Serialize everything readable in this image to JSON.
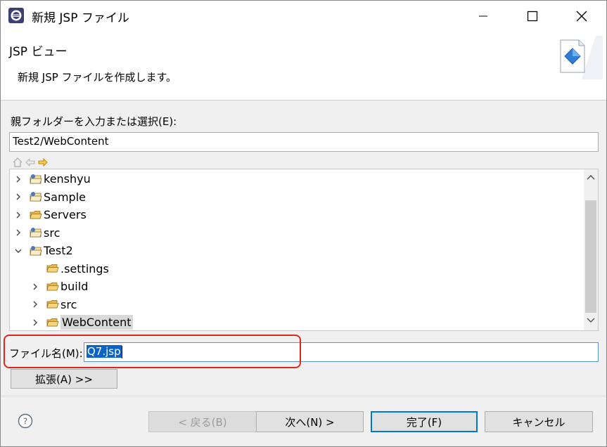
{
  "window": {
    "title": "新規 JSP ファイル"
  },
  "banner": {
    "title": "JSP ビュー",
    "description": "新規 JSP ファイルを作成します。"
  },
  "parent_folder": {
    "label": "親フォルダーを入力または選択(E):",
    "value": "Test2/WebContent"
  },
  "tree": {
    "items": [
      {
        "label": "kenshyu",
        "level": 0,
        "expander": "collapsed",
        "icon": "project-icon"
      },
      {
        "label": "Sample",
        "level": 0,
        "expander": "collapsed",
        "icon": "project-icon"
      },
      {
        "label": "Servers",
        "level": 0,
        "expander": "collapsed",
        "icon": "folder-icon"
      },
      {
        "label": "src",
        "level": 0,
        "expander": "collapsed",
        "icon": "project-icon"
      },
      {
        "label": "Test2",
        "level": 0,
        "expander": "expanded",
        "icon": "project-icon"
      },
      {
        "label": ".settings",
        "level": 1,
        "expander": "none",
        "icon": "folder-icon"
      },
      {
        "label": "build",
        "level": 1,
        "expander": "collapsed",
        "icon": "folder-icon"
      },
      {
        "label": "src",
        "level": 1,
        "expander": "collapsed",
        "icon": "folder-icon"
      },
      {
        "label": "WebContent",
        "level": 1,
        "expander": "collapsed",
        "icon": "folder-icon",
        "selected": true
      }
    ]
  },
  "filename": {
    "label": "ファイル名(M):",
    "value": "Q7.jsp"
  },
  "buttons": {
    "advanced": "拡張(A) >>",
    "back": "< 戻る(B)",
    "next": "次へ(N) >",
    "finish": "完了(F)",
    "cancel": "キャンセル"
  },
  "colors": {
    "accent": "#0078d7",
    "selection": "#0a64c8",
    "highlight": "#e0261b"
  }
}
